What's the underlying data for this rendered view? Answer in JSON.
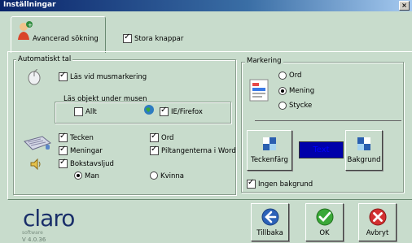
{
  "window": {
    "title": "Inställningar"
  },
  "tabs": {
    "active_tab": "Avancerad sökning",
    "large_buttons_label": "Stora knappar"
  },
  "auto_speech": {
    "legend": "Automatiskt tal",
    "read_on_mouse_mark": "Läs vid musmarkering",
    "under_mouse_legend": "Läs objekt under musen",
    "all_label": "Allt",
    "ie_firefox_label": "IE/Firefox",
    "characters": "Tecken",
    "sentences": "Meningar",
    "letter_sounds": "Bokstavsljud",
    "words": "Ord",
    "arrow_keys": "Piltangenterna i Word",
    "male": "Man",
    "female": "Kvinna"
  },
  "marking": {
    "legend": "Markering",
    "word": "Ord",
    "sentence": "Mening",
    "paragraph": "Stycke",
    "text_color_button": "Teckenfärg",
    "preview_text": "Text",
    "background_button": "Bakgrund",
    "no_background": "Ingen bakgrund"
  },
  "footer": {
    "logo": "claro",
    "logo_sub": "software",
    "version": "V 4.0.36",
    "back": "Tillbaka",
    "ok": "OK",
    "cancel": "Avbryt"
  },
  "colors": {
    "accent": "#0a246a",
    "preview_bg": "#0000aa",
    "preview_text": "#0000ff",
    "ok": "#3aa838",
    "cancel": "#d23030"
  }
}
